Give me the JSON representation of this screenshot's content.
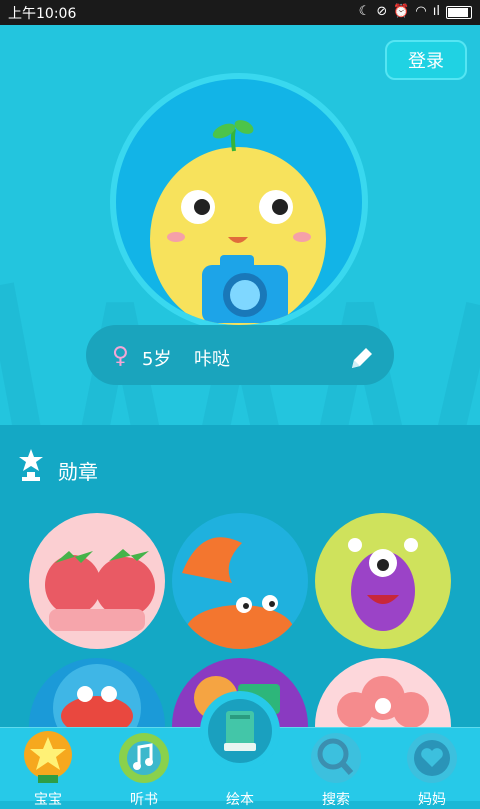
{
  "status_bar": {
    "time": "上午10:06",
    "signal_text": "ıl"
  },
  "header": {
    "login_label": "登录"
  },
  "profile": {
    "gender_symbol": "♀",
    "age": "5岁",
    "nickname": "咔哒"
  },
  "medals": {
    "title": "勋章"
  },
  "tabs": [
    {
      "label": "宝宝",
      "icon": "star-trophy-icon"
    },
    {
      "label": "听书",
      "icon": "music-note-icon"
    },
    {
      "label": "绘本",
      "icon": "book-icon"
    },
    {
      "label": "搜索",
      "icon": "magnifier-icon"
    },
    {
      "label": "妈妈",
      "icon": "heart-gear-icon"
    }
  ],
  "colors": {
    "bg": "#1bb8d6",
    "header": "#23c5de",
    "accent": "#27c9e8"
  }
}
